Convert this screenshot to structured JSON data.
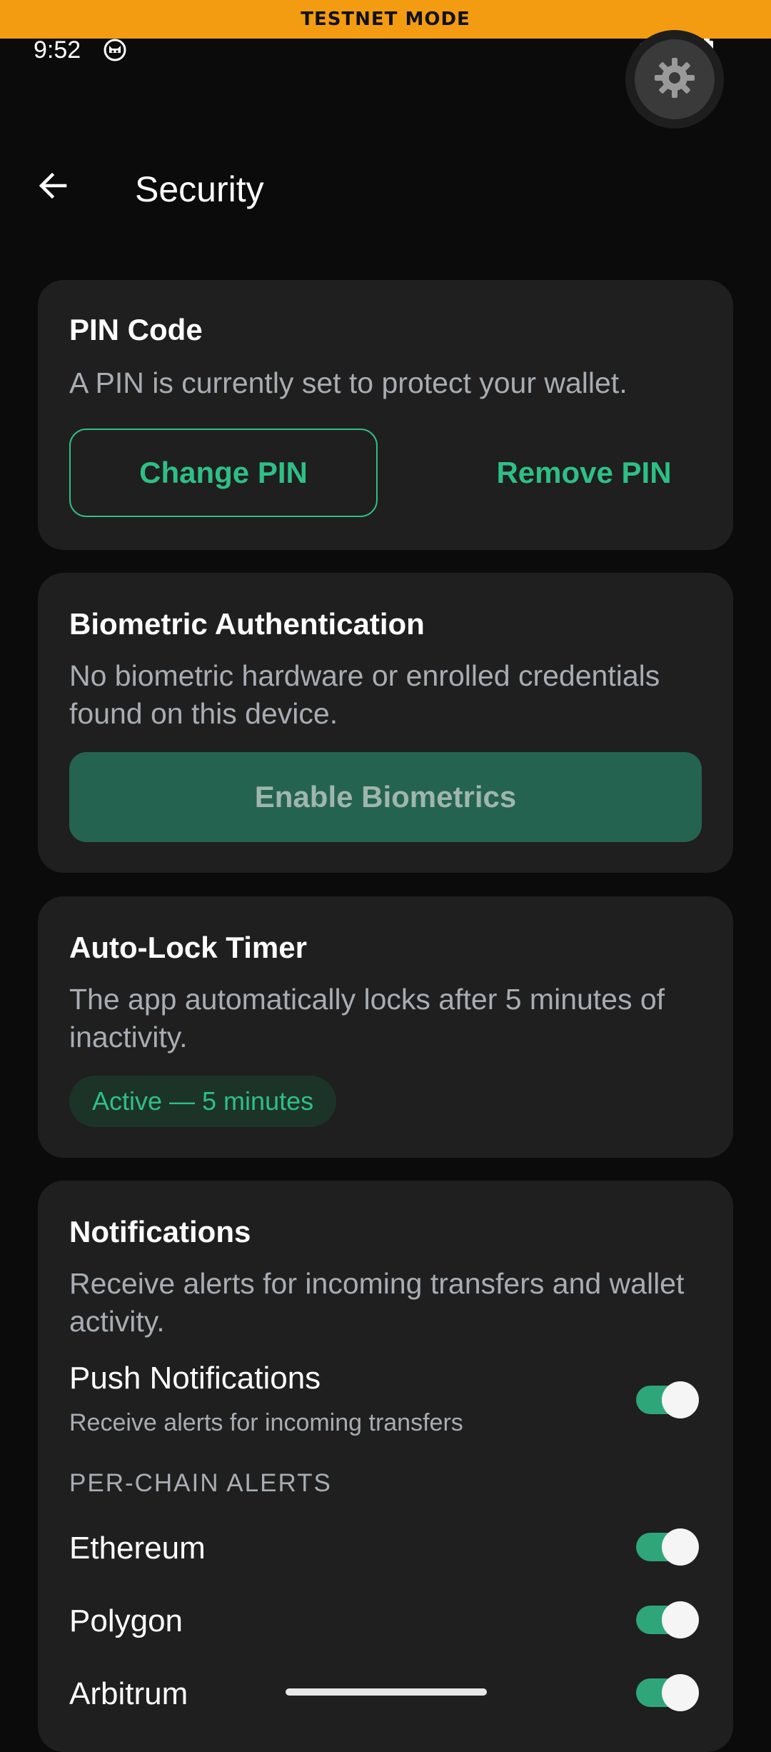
{
  "banner": {
    "text": "TESTNET MODE"
  },
  "status_bar": {
    "time": "9:52",
    "icons": [
      "cat-notification-icon",
      "wifi-icon",
      "signal-icon",
      "battery-charging-icon"
    ]
  },
  "floating_button": {
    "icon": "gear-icon"
  },
  "app_bar": {
    "back_icon": "arrow-left-icon",
    "title": "Security"
  },
  "pin_card": {
    "title": "PIN Code",
    "description": "A PIN is currently set to protect your wallet.",
    "change_label": "Change PIN",
    "remove_label": "Remove PIN"
  },
  "biometric_card": {
    "title": "Biometric Authentication",
    "description": "No biometric hardware or enrolled credentials found on this device.",
    "enable_label": "Enable Biometrics"
  },
  "autolock_card": {
    "title": "Auto-Lock Timer",
    "description": "The app automatically locks after 5 minutes of inactivity.",
    "status_pill": "Active — 5 minutes"
  },
  "notifications_card": {
    "title": "Notifications",
    "description": "Receive alerts for incoming transfers and wallet activity.",
    "push": {
      "label": "Push Notifications",
      "sublabel": "Receive alerts for incoming transfers",
      "enabled": true
    },
    "per_chain_header": "PER-CHAIN ALERTS",
    "chains": [
      {
        "label": "Ethereum",
        "enabled": true
      },
      {
        "label": "Polygon",
        "enabled": true
      },
      {
        "label": "Arbitrum",
        "enabled": true
      }
    ]
  },
  "colors": {
    "background": "#0b0b0b",
    "card": "#1f1f1f",
    "accent": "#2fbf86",
    "banner": "#f39c12",
    "muted_text": "#a8adb3"
  }
}
